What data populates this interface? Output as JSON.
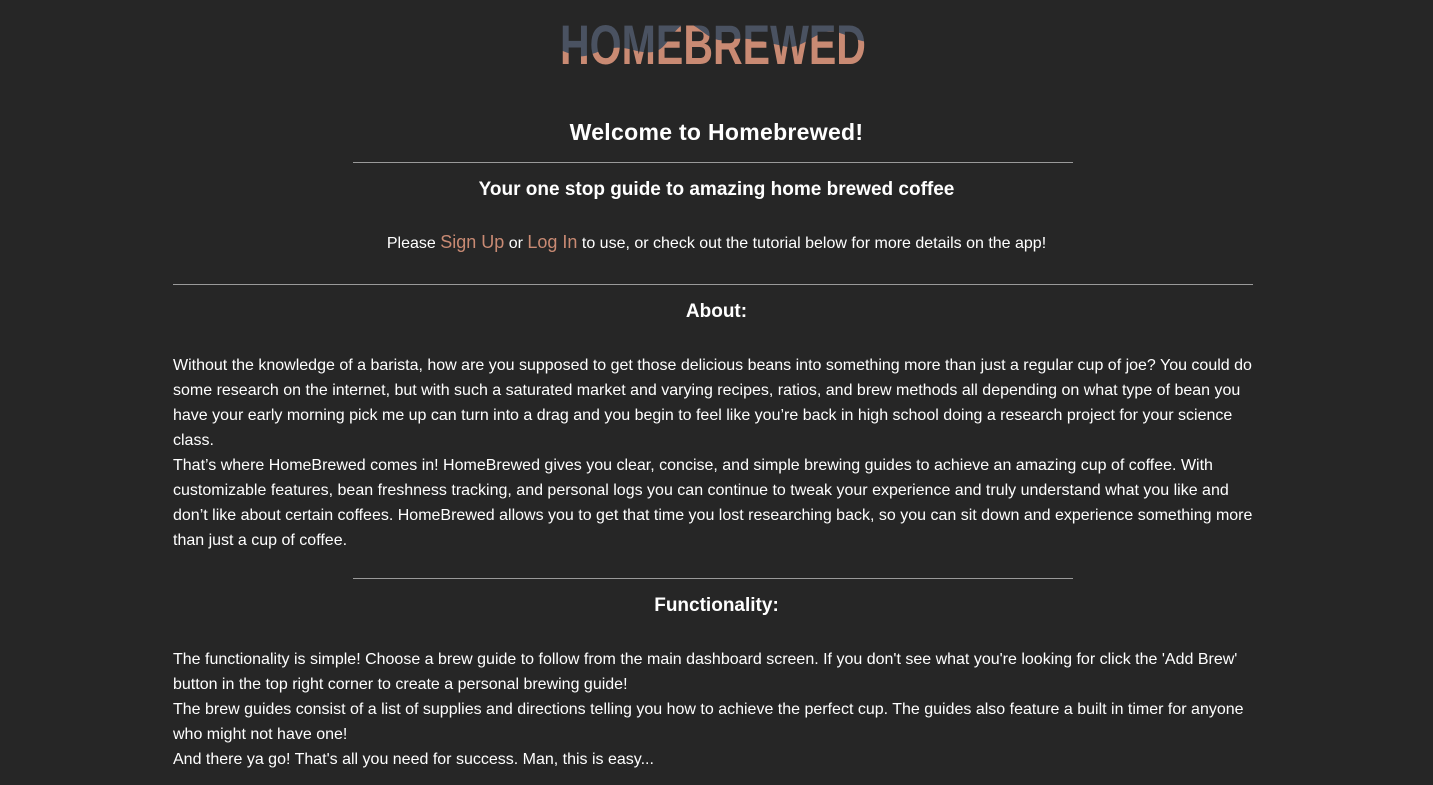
{
  "logo": {
    "text": "HOMEBREWED",
    "colors": {
      "top": "#4a5261",
      "bottom": "#c98a73"
    }
  },
  "header": {
    "welcome": "Welcome to Homebrewed!",
    "tagline": "Your one stop guide to amazing home brewed coffee"
  },
  "cta": {
    "prefix": "Please ",
    "signup_label": "Sign Up",
    "middle": " or ",
    "login_label": "Log In",
    "suffix": " to use, or check out the tutorial below for more details on the app!"
  },
  "about": {
    "title": "About:",
    "paragraphs": [
      "Without the knowledge of a barista, how are you supposed to get those delicious beans into something more than just a regular cup of joe? You could do some research on the internet, but with such a saturated market and varying recipes, ratios, and brew methods all depending on what type of bean you have your early morning pick me up can turn into a drag and you begin to feel like you’re back in high school doing a research project for your science class.",
      "That’s where HomeBrewed comes in! HomeBrewed gives you clear, concise, and simple brewing guides to achieve an amazing cup of coffee. With customizable features, bean freshness tracking, and personal logs you can continue to tweak your experience and truly understand what you like and don’t like about certain coffees. HomeBrewed allows you to get that time you lost researching back, so you can sit down and experience something more than just a cup of coffee."
    ]
  },
  "functionality": {
    "title": "Functionality:",
    "paragraphs": [
      "The functionality is simple! Choose a brew guide to follow from the main dashboard screen. If you don't see what you're looking for click the 'Add Brew' button in the top right corner to create a personal brewing guide!",
      "The brew guides consist of a list of supplies and directions telling you how to achieve the perfect cup. The guides also feature a built in timer for anyone who might not have one!",
      "And there ya go! That's all you need for success. Man, this is easy..."
    ]
  },
  "colors": {
    "background": "#262626",
    "text": "#ffffff",
    "link": "#c98a73",
    "rule": "#9a9a9a"
  }
}
